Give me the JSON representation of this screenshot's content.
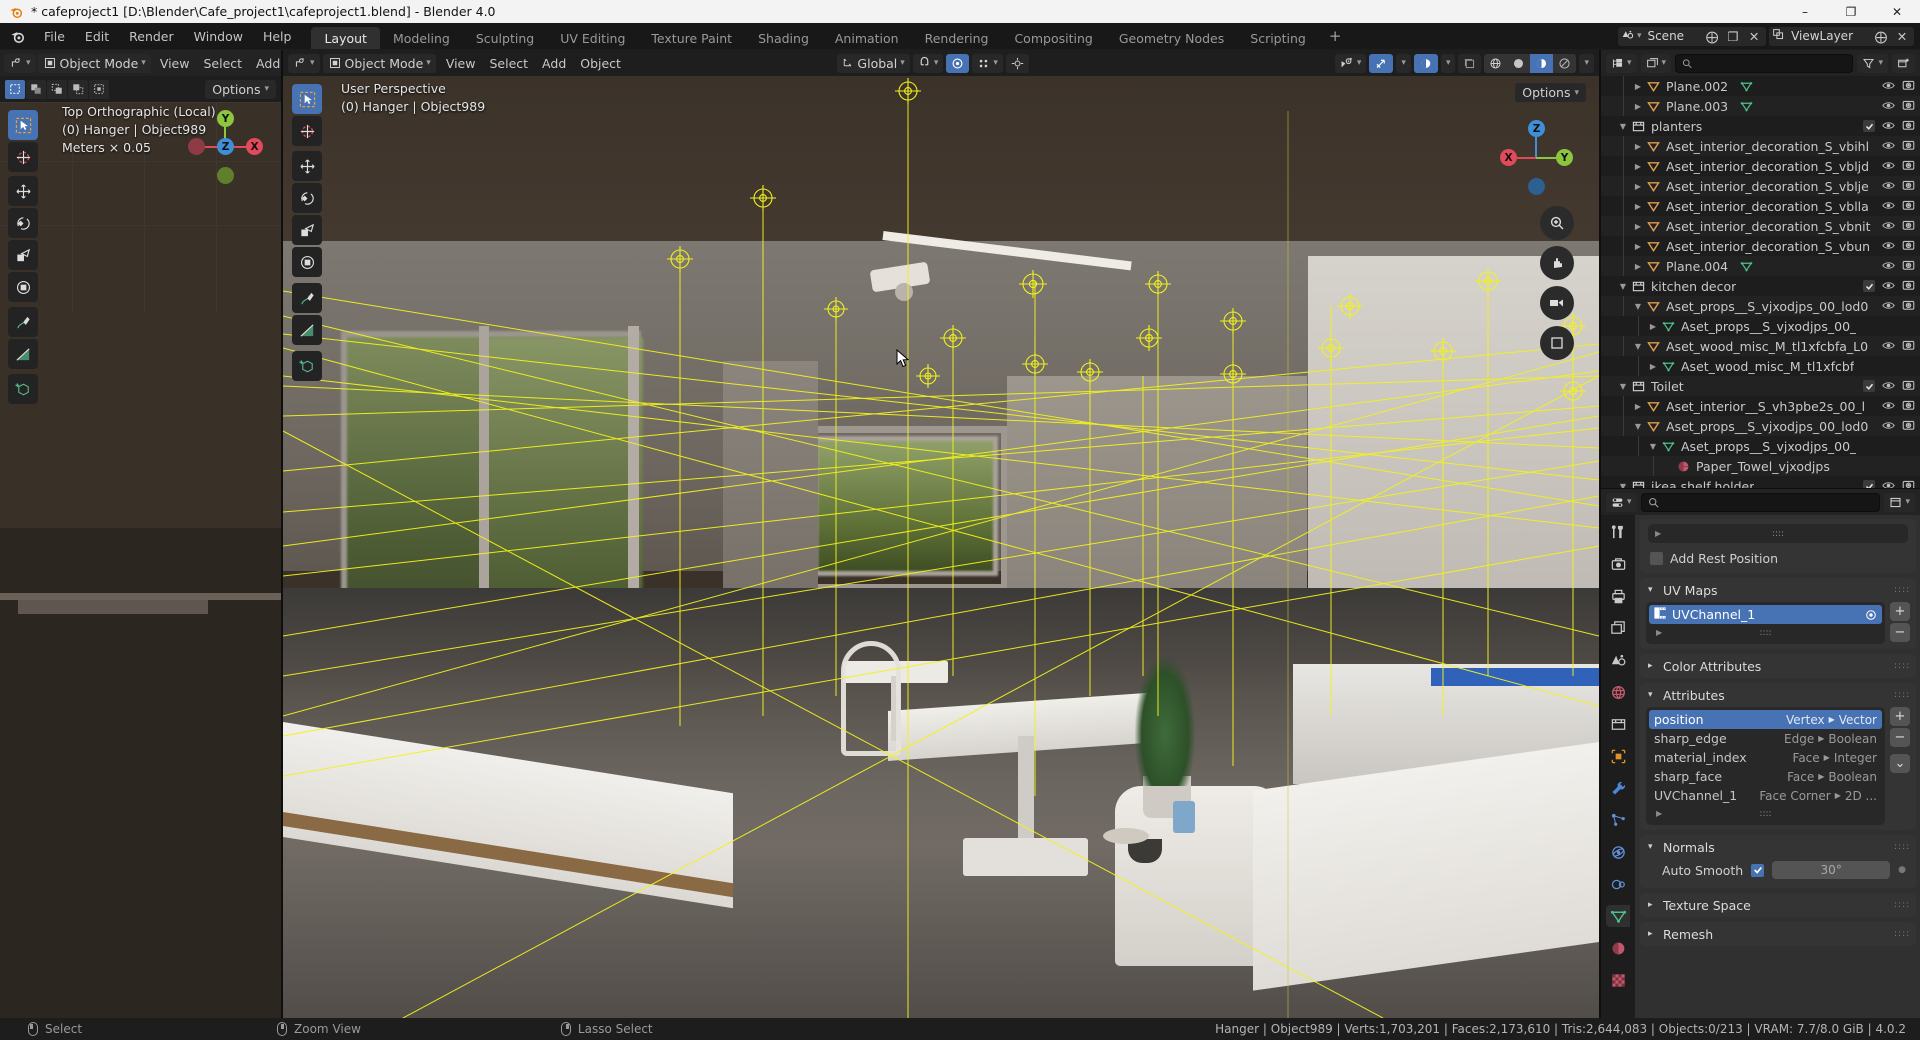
{
  "window": {
    "title": "* cafeproject1 [D:\\Blender\\Cafe_project1\\cafeproject1.blend] - Blender 4.0",
    "minimize": "–",
    "maximize": "❐",
    "close": "✕"
  },
  "topbar": {
    "menus": [
      "File",
      "Edit",
      "Render",
      "Window",
      "Help"
    ],
    "workspaces": [
      {
        "label": "Layout",
        "active": true
      },
      {
        "label": "Modeling",
        "active": false
      },
      {
        "label": "Sculpting",
        "active": false
      },
      {
        "label": "UV Editing",
        "active": false
      },
      {
        "label": "Texture Paint",
        "active": false
      },
      {
        "label": "Shading",
        "active": false
      },
      {
        "label": "Animation",
        "active": false
      },
      {
        "label": "Rendering",
        "active": false
      },
      {
        "label": "Compositing",
        "active": false
      },
      {
        "label": "Geometry Nodes",
        "active": false
      },
      {
        "label": "Scripting",
        "active": false
      }
    ],
    "add_workspace": "+",
    "scene_name": "Scene",
    "viewlayer_name": "ViewLayer"
  },
  "left_editor": {
    "mode": "Object Mode",
    "menus": [
      "View",
      "Select",
      "Add"
    ],
    "options_label": "Options",
    "overlay_lines": [
      "Top Orthographic (Local)",
      "(0) Hanger | Object989",
      "Meters × 0.05"
    ],
    "gizmo_axes": [
      "Y",
      "Z",
      "X"
    ]
  },
  "main_viewport": {
    "mode": "Object Mode",
    "menus": [
      "View",
      "Select",
      "Add",
      "Object"
    ],
    "transform_orientation": "Global",
    "options_label": "Options",
    "overlay_lines": [
      "User Perspective",
      "(0) Hanger | Object989"
    ],
    "gizmo_axes": [
      "Z",
      "X",
      "Y"
    ],
    "shading_modes": [
      "wireframe",
      "solid",
      "material-preview",
      "rendered"
    ],
    "active_shading": "material-preview"
  },
  "outliner": {
    "search_placeholder": "",
    "rows": [
      {
        "indent": 2,
        "tri": "▶",
        "icon": "mesh-object",
        "label": "Plane.002",
        "data_icon": "mesh-data",
        "check": false,
        "eye": true,
        "cam": true
      },
      {
        "indent": 2,
        "tri": "▶",
        "icon": "mesh-object",
        "label": "Plane.003",
        "data_icon": "mesh-data",
        "check": false,
        "eye": true,
        "cam": true
      },
      {
        "indent": 1,
        "tri": "▼",
        "icon": "collection",
        "label": "planters",
        "data_icon": "",
        "check": true,
        "eye": true,
        "cam": true
      },
      {
        "indent": 2,
        "tri": "▶",
        "icon": "mesh-object",
        "label": "Aset_interior_decoration_S_vbihl",
        "data_icon": "",
        "check": false,
        "eye": true,
        "cam": true
      },
      {
        "indent": 2,
        "tri": "▶",
        "icon": "mesh-object",
        "label": "Aset_interior_decoration_S_vbljd",
        "data_icon": "",
        "check": false,
        "eye": true,
        "cam": true
      },
      {
        "indent": 2,
        "tri": "▶",
        "icon": "mesh-object",
        "label": "Aset_interior_decoration_S_vblje",
        "data_icon": "",
        "check": false,
        "eye": true,
        "cam": true
      },
      {
        "indent": 2,
        "tri": "▶",
        "icon": "mesh-object",
        "label": "Aset_interior_decoration_S_vblla",
        "data_icon": "",
        "check": false,
        "eye": true,
        "cam": true
      },
      {
        "indent": 2,
        "tri": "▶",
        "icon": "mesh-object",
        "label": "Aset_interior_decoration_S_vbnit",
        "data_icon": "",
        "check": false,
        "eye": true,
        "cam": true
      },
      {
        "indent": 2,
        "tri": "▶",
        "icon": "mesh-object",
        "label": "Aset_interior_decoration_S_vbun",
        "data_icon": "",
        "check": false,
        "eye": true,
        "cam": true
      },
      {
        "indent": 2,
        "tri": "▶",
        "icon": "mesh-object",
        "label": "Plane.004",
        "data_icon": "mesh-data",
        "check": false,
        "eye": true,
        "cam": true
      },
      {
        "indent": 1,
        "tri": "▼",
        "icon": "collection",
        "label": "kitchen decor",
        "data_icon": "",
        "check": true,
        "eye": true,
        "cam": true
      },
      {
        "indent": 2,
        "tri": "▼",
        "icon": "mesh-object",
        "label": "Aset_props__S_vjxodjps_00_lod0",
        "data_icon": "",
        "check": false,
        "eye": true,
        "cam": true
      },
      {
        "indent": 3,
        "tri": "▶",
        "icon": "mesh-data",
        "label": "Aset_props__S_vjxodjps_00_",
        "data_icon": "",
        "check": false,
        "eye": false,
        "cam": false
      },
      {
        "indent": 2,
        "tri": "▼",
        "icon": "mesh-object",
        "label": "Aset_wood_misc_M_tl1xfcbfa_L0",
        "data_icon": "",
        "check": false,
        "eye": true,
        "cam": true
      },
      {
        "indent": 3,
        "tri": "▶",
        "icon": "mesh-data",
        "label": "Aset_wood_misc_M_tl1xfcbf",
        "data_icon": "",
        "check": false,
        "eye": false,
        "cam": false
      },
      {
        "indent": 1,
        "tri": "▼",
        "icon": "collection",
        "label": "Toilet",
        "data_icon": "",
        "check": true,
        "eye": true,
        "cam": true
      },
      {
        "indent": 2,
        "tri": "▶",
        "icon": "mesh-object",
        "label": "Aset_interior__S_vh3pbe2s_00_l",
        "data_icon": "",
        "check": false,
        "eye": true,
        "cam": true
      },
      {
        "indent": 2,
        "tri": "▼",
        "icon": "mesh-object",
        "label": "Aset_props__S_vjxodjps_00_lod0",
        "data_icon": "",
        "check": false,
        "eye": true,
        "cam": true
      },
      {
        "indent": 3,
        "tri": "▼",
        "icon": "mesh-data",
        "label": "Aset_props__S_vjxodjps_00_",
        "data_icon": "",
        "check": false,
        "eye": false,
        "cam": false
      },
      {
        "indent": 4,
        "tri": "",
        "icon": "material",
        "label": "Paper_Towel_vjxodjps",
        "data_icon": "",
        "check": false,
        "eye": false,
        "cam": false
      },
      {
        "indent": 1,
        "tri": "▼",
        "icon": "collection",
        "label": "ikea shelf holder",
        "data_icon": "",
        "check": true,
        "eye": true,
        "cam": true
      }
    ]
  },
  "properties": {
    "tabs": [
      {
        "name": "tool",
        "glyph": "⚒",
        "active": false
      },
      {
        "name": "render",
        "glyph": "▣",
        "active": false
      },
      {
        "name": "output",
        "glyph": "⎙",
        "active": false
      },
      {
        "name": "view-layer",
        "glyph": "⧉",
        "active": false
      },
      {
        "name": "scene",
        "glyph": "◔",
        "active": false
      },
      {
        "name": "world",
        "glyph": "◍",
        "active": false
      },
      {
        "name": "collection",
        "glyph": "☰",
        "active": false
      },
      {
        "name": "object",
        "glyph": "■",
        "active": false
      },
      {
        "name": "modifiers",
        "glyph": "🔧",
        "active": false
      },
      {
        "name": "particles",
        "glyph": "⁂",
        "active": false
      },
      {
        "name": "physics",
        "glyph": "⌾",
        "active": false
      },
      {
        "name": "constraints",
        "glyph": "⚭",
        "active": false
      },
      {
        "name": "data",
        "glyph": "▽",
        "active": true
      },
      {
        "name": "material",
        "glyph": "◕",
        "active": false
      },
      {
        "name": "texture",
        "glyph": "▦",
        "active": false
      }
    ],
    "vertex_groups_footer": "",
    "add_rest_position": "Add Rest Position",
    "uv_maps": {
      "title": "UV Maps",
      "items": [
        {
          "label": "UVChannel_1",
          "selected": true
        }
      ],
      "add": "+",
      "remove": "−"
    },
    "color_attributes": {
      "title": "Color Attributes"
    },
    "attributes": {
      "title": "Attributes",
      "items": [
        {
          "name": "position",
          "domain": "Vertex",
          "type": "Vector",
          "selected": true
        },
        {
          "name": "sharp_edge",
          "domain": "Edge",
          "type": "Boolean",
          "selected": false
        },
        {
          "name": "material_index",
          "domain": "Face",
          "type": "Integer",
          "selected": false
        },
        {
          "name": "sharp_face",
          "domain": "Face",
          "type": "Boolean",
          "selected": false
        },
        {
          "name": "UVChannel_1",
          "domain": "Face Corner",
          "type": "2D ...",
          "selected": false
        }
      ],
      "add": "+",
      "remove": "−",
      "menu": "⌄"
    },
    "normals": {
      "title": "Normals",
      "auto_smooth_label": "Auto Smooth",
      "auto_smooth_on": true,
      "angle": "30°"
    },
    "texture_space": {
      "title": "Texture Space"
    },
    "remesh": {
      "title": "Remesh"
    }
  },
  "statusbar": {
    "hints": [
      {
        "mouse": "left",
        "label": "Select"
      },
      {
        "mouse": "mid",
        "label": "Zoom View"
      },
      {
        "mouse": "right",
        "label": "Lasso Select"
      }
    ],
    "stats": "Hanger | Object989 | Verts:1,703,201 | Faces:2,173,610 | Tris:2,644,083 | Objects:0/213 | VRAM: 7.7/8.0 GiB | 4.0.2"
  },
  "colors": {
    "accent": "#4772b3",
    "wire_yellow": "#f2f21d",
    "mesh_orange": "#e09a51",
    "mesh_green": "#4ec08c",
    "axis_x": "#e04a5a",
    "axis_y": "#8cc63f",
    "axis_z": "#3f8fd8"
  }
}
